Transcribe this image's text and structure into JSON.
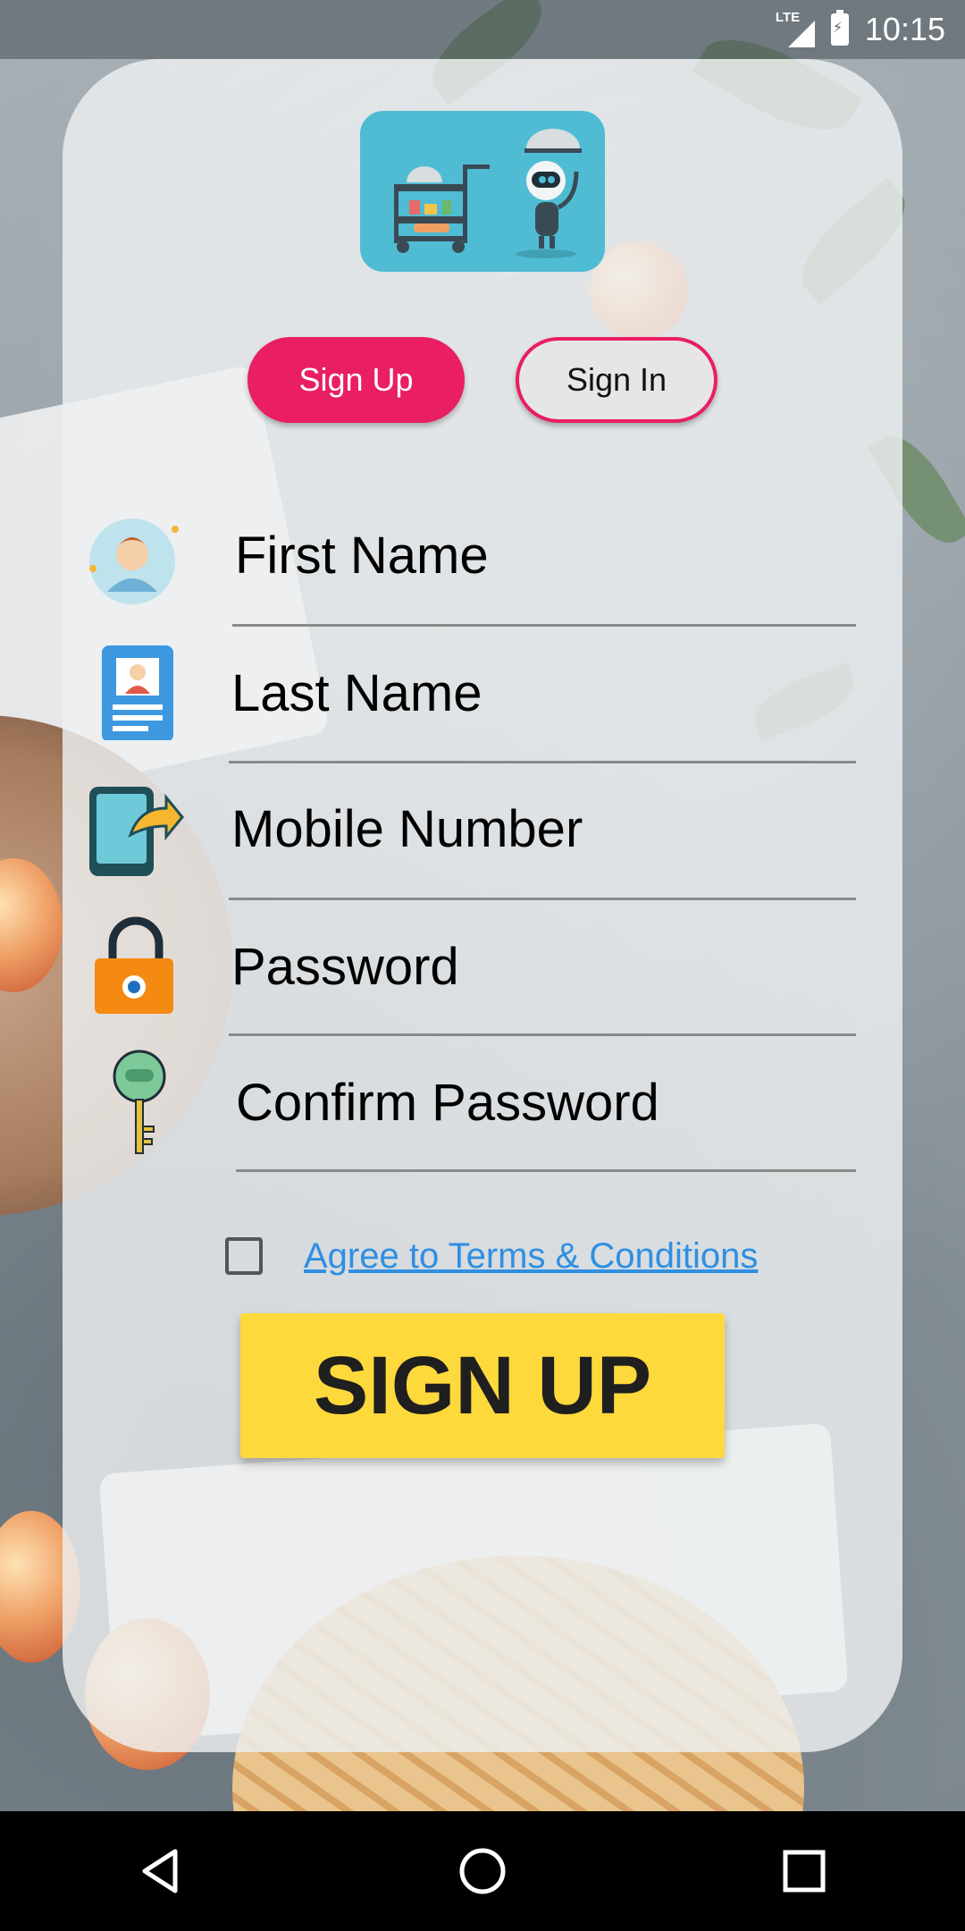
{
  "status_bar": {
    "network_label": "LTE",
    "time": "10:15",
    "icons": [
      "signal-icon",
      "battery-charging-icon"
    ]
  },
  "logo": {
    "icon": "robot-waiter-cart-logo"
  },
  "tabs": {
    "signup_label": "Sign Up",
    "signin_label": "Sign In",
    "active": "signup"
  },
  "form": {
    "fields": [
      {
        "label": "First Name",
        "icon": "person-avatar-icon"
      },
      {
        "label": "Last Name",
        "icon": "id-card-icon"
      },
      {
        "label": "Mobile Number",
        "icon": "phone-forward-icon"
      },
      {
        "label": "Password",
        "icon": "padlock-icon"
      },
      {
        "label": "Confirm Password",
        "icon": "key-icon"
      }
    ],
    "terms_label": "Agree to Terms & Conditions",
    "terms_checked": false,
    "submit_label": "SIGN UP"
  },
  "colors": {
    "primary_pink": "#e91e63",
    "submit_yellow": "#fed93b",
    "link_blue": "#2f8fe3",
    "logo_bg": "#4fbcd4"
  },
  "nav_bar": {
    "icons": [
      "back-icon",
      "home-icon",
      "recents-icon"
    ]
  }
}
